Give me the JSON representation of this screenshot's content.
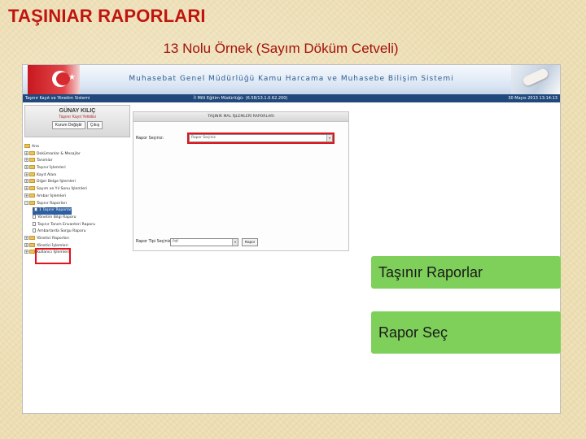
{
  "slide": {
    "title": "TAŞINIAR RAPORLARI",
    "subtitle": "13 Nolu Örnek (Sayım Döküm Cetveli)"
  },
  "screenshot": {
    "banner_title": "Muhasebat Genel Müdürlüğü Kamu Harcama ve Muhasebe Bilişim Sistemi",
    "info_left": "Taşınır Kayıt ve Yönetim Sistemi",
    "info_center": "İl Milli Eğitim Müdürlüğü- (6.58/13.1.0.62.200)",
    "info_right": "30 Mayıs 2013 13:14:13",
    "user": {
      "name": "GÜNAY KILIÇ",
      "role": "Taşınır Kayıt Yetkilisi",
      "change_button": "Kurum Değiştir",
      "logout_button": "Çıkış"
    },
    "tree": {
      "root": "Ana",
      "items": [
        "Dokümanlar & Mesajlar",
        "Tanımlar",
        "Taşınır İşlemleri",
        "Kayıt Alanı",
        "Diğer Belge İşlemleri",
        "Sayım ve Yıl Sonu İşlemleri",
        "Ambar İşlemleri",
        "Taşınır Raporları",
        "1 Taşınır Raporları",
        "Yönetim Bilgi Raporu",
        "Taşınır Tanım Envanteri Raporu",
        "Ambarlarda Sorgu Raporu",
        "Yönetici Raporları",
        "Yönetici İşlemleri",
        "Kullanıcı İşlemleri"
      ]
    },
    "panel": {
      "title": "TAŞINIR MAL İŞLEMLERİ RAPORLARI",
      "report_label": "Rapor Seçiniz:",
      "report_value": "Rapor Seçiniz",
      "type_label": "Rapor Tipi Seçiniz:",
      "type_value": "Pdf",
      "report_button": "Rapor"
    }
  },
  "callouts": {
    "first": "Taşınır Raporlar",
    "second": "Rapor Seç"
  },
  "colors": {
    "title_red": "#c0150f",
    "highlight_red": "#e0141c",
    "callout_green": "#7ed05a",
    "infobar_blue": "#20487c"
  }
}
